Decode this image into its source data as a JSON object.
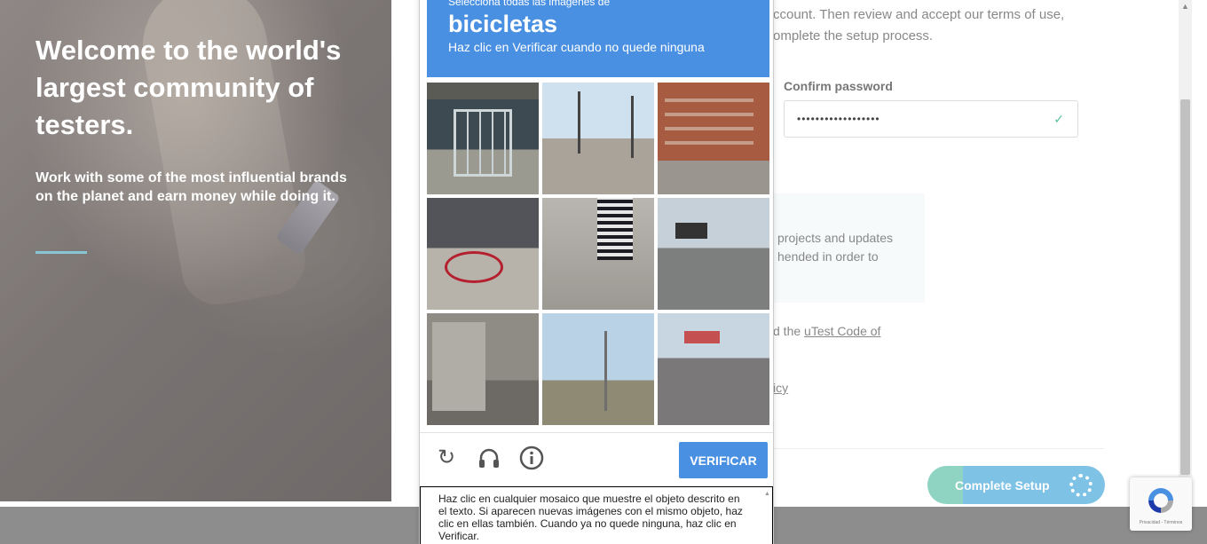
{
  "hero": {
    "title": "Welcome to the world's largest community of testers.",
    "subtitle": "Work with some of the most influential brands on the planet and earn money while doing it."
  },
  "form": {
    "intro_line1": "ccount. Then review and accept our terms of use,",
    "intro_line2": "omplete the setup process.",
    "confirm_password_label": "Confirm password",
    "confirm_password_value": "••••••••••••••••••",
    "notice_line1": "projects and updates",
    "notice_line2": "hended in order to",
    "code_line_prefix": "d the ",
    "code_link": "uTest Code of",
    "policy_link": "icy",
    "complete_button": "Complete Setup"
  },
  "captcha": {
    "select_all_text": "Selecciona todas las imágenes de",
    "target_object": "bicicletas",
    "instruction": "Haz clic en Verificar cuando no quede ninguna",
    "verify_button": "VERIFICAR",
    "help_text": "Haz clic en cualquier mosaico que muestre el objeto descrito en el texto. Si aparecen nuevas imágenes con el mismo objeto, haz clic en ellas también. Cuando ya no quede ninguna, haz clic en Verificar.",
    "tiles": [
      "tile-1",
      "tile-2",
      "tile-3",
      "tile-4",
      "tile-5",
      "tile-6",
      "tile-7",
      "tile-8",
      "tile-9"
    ],
    "icons": [
      "reload-icon",
      "audio-icon",
      "info-icon"
    ]
  },
  "recaptcha_badge": {
    "links": "Privacidad - Términos"
  },
  "colors": {
    "captcha_blue": "#4a90e2",
    "accent_line": "#88c6d6",
    "check_green": "#5cbfa0"
  }
}
